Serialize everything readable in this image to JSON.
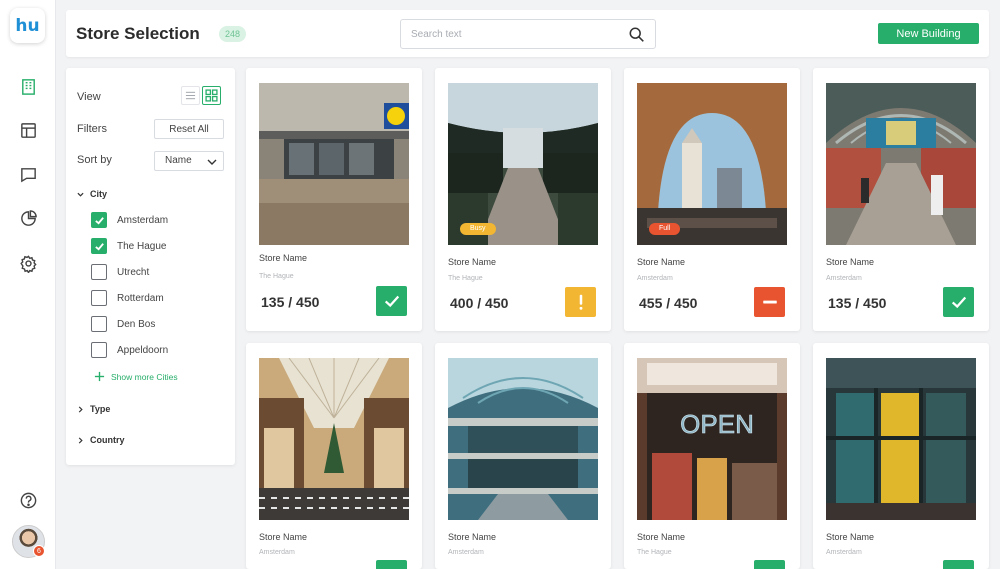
{
  "app": {
    "logo_text": "hu",
    "nav_icons": [
      "building-icon",
      "layout-icon",
      "chat-icon",
      "pie-chart-icon",
      "gear-icon"
    ],
    "help_icon": "help-icon",
    "avatar_badge": "6"
  },
  "header": {
    "title": "Store Selection",
    "count": "248",
    "search_placeholder": "Search text",
    "new_button": "New Building"
  },
  "filters": {
    "view_label": "View",
    "filters_label": "Filters",
    "reset_label": "Reset All",
    "sort_label": "Sort by",
    "sort_value": "Name",
    "city_section": "City",
    "cities": [
      {
        "label": "Amsterdam",
        "checked": true
      },
      {
        "label": "The Hague",
        "checked": true
      },
      {
        "label": "Utrecht",
        "checked": false
      },
      {
        "label": "Rotterdam",
        "checked": false
      },
      {
        "label": "Den Bos",
        "checked": false
      },
      {
        "label": "Appeldoorn",
        "checked": false
      }
    ],
    "show_more": "Show more Cities",
    "type_section": "Type",
    "country_section": "Country"
  },
  "colors": {
    "accent": "#27ae6a",
    "warning": "#f2b632",
    "danger": "#e8542f"
  },
  "stores": [
    {
      "name": "Store Name",
      "city": "The Hague",
      "capacity": "135 / 450",
      "status": "ok",
      "tag": ""
    },
    {
      "name": "Store Name",
      "city": "The Hague",
      "capacity": "400 / 450",
      "status": "warning",
      "tag": "Busy"
    },
    {
      "name": "Store Name",
      "city": "Amsterdam",
      "capacity": "455 / 450",
      "status": "full",
      "tag": "Full"
    },
    {
      "name": "Store Name",
      "city": "Amsterdam",
      "capacity": "135 / 450",
      "status": "ok",
      "tag": ""
    },
    {
      "name": "Store Name",
      "city": "Amsterdam",
      "capacity": "",
      "status": "ok",
      "tag": ""
    },
    {
      "name": "Store Name",
      "city": "Amsterdam",
      "capacity": "",
      "status": "",
      "tag": ""
    },
    {
      "name": "Store Name",
      "city": "The Hague",
      "capacity": "",
      "status": "ok",
      "tag": "",
      "sign_text": "OPEN"
    },
    {
      "name": "Store Name",
      "city": "Amsterdam",
      "capacity": "",
      "status": "ok",
      "tag": ""
    }
  ]
}
